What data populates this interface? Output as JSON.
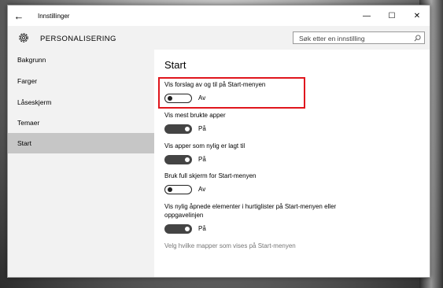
{
  "window": {
    "title": "Innstillinger"
  },
  "header": {
    "app_title": "PERSONALISERING",
    "search_placeholder": "Søk etter en innstilling"
  },
  "sidebar": {
    "items": [
      {
        "label": "Bakgrunn"
      },
      {
        "label": "Farger"
      },
      {
        "label": "Låseskjerm"
      },
      {
        "label": "Temaer"
      },
      {
        "label": "Start"
      }
    ],
    "active": "Start"
  },
  "content": {
    "title": "Start",
    "options": [
      {
        "label": "Vis forslag av og til på Start-menyen",
        "state": "Av",
        "on": false
      },
      {
        "label": "Vis mest brukte apper",
        "state": "På",
        "on": true
      },
      {
        "label": "Vis apper som nylig er lagt til",
        "state": "På",
        "on": true
      },
      {
        "label": "Bruk full skjerm for Start-menyen",
        "state": "Av",
        "on": false
      },
      {
        "label": "Vis nylig åpnede elementer i hurtiglister på Start-menyen eller oppgavelinjen",
        "state": "På",
        "on": true
      }
    ],
    "link": "Velg hvilke mapper som vises på Start-menyen"
  },
  "colors": {
    "accent_highlight": "#e0161d",
    "sidebar_bg": "#f2f2f2",
    "active_item_bg": "#c6c6c6"
  }
}
